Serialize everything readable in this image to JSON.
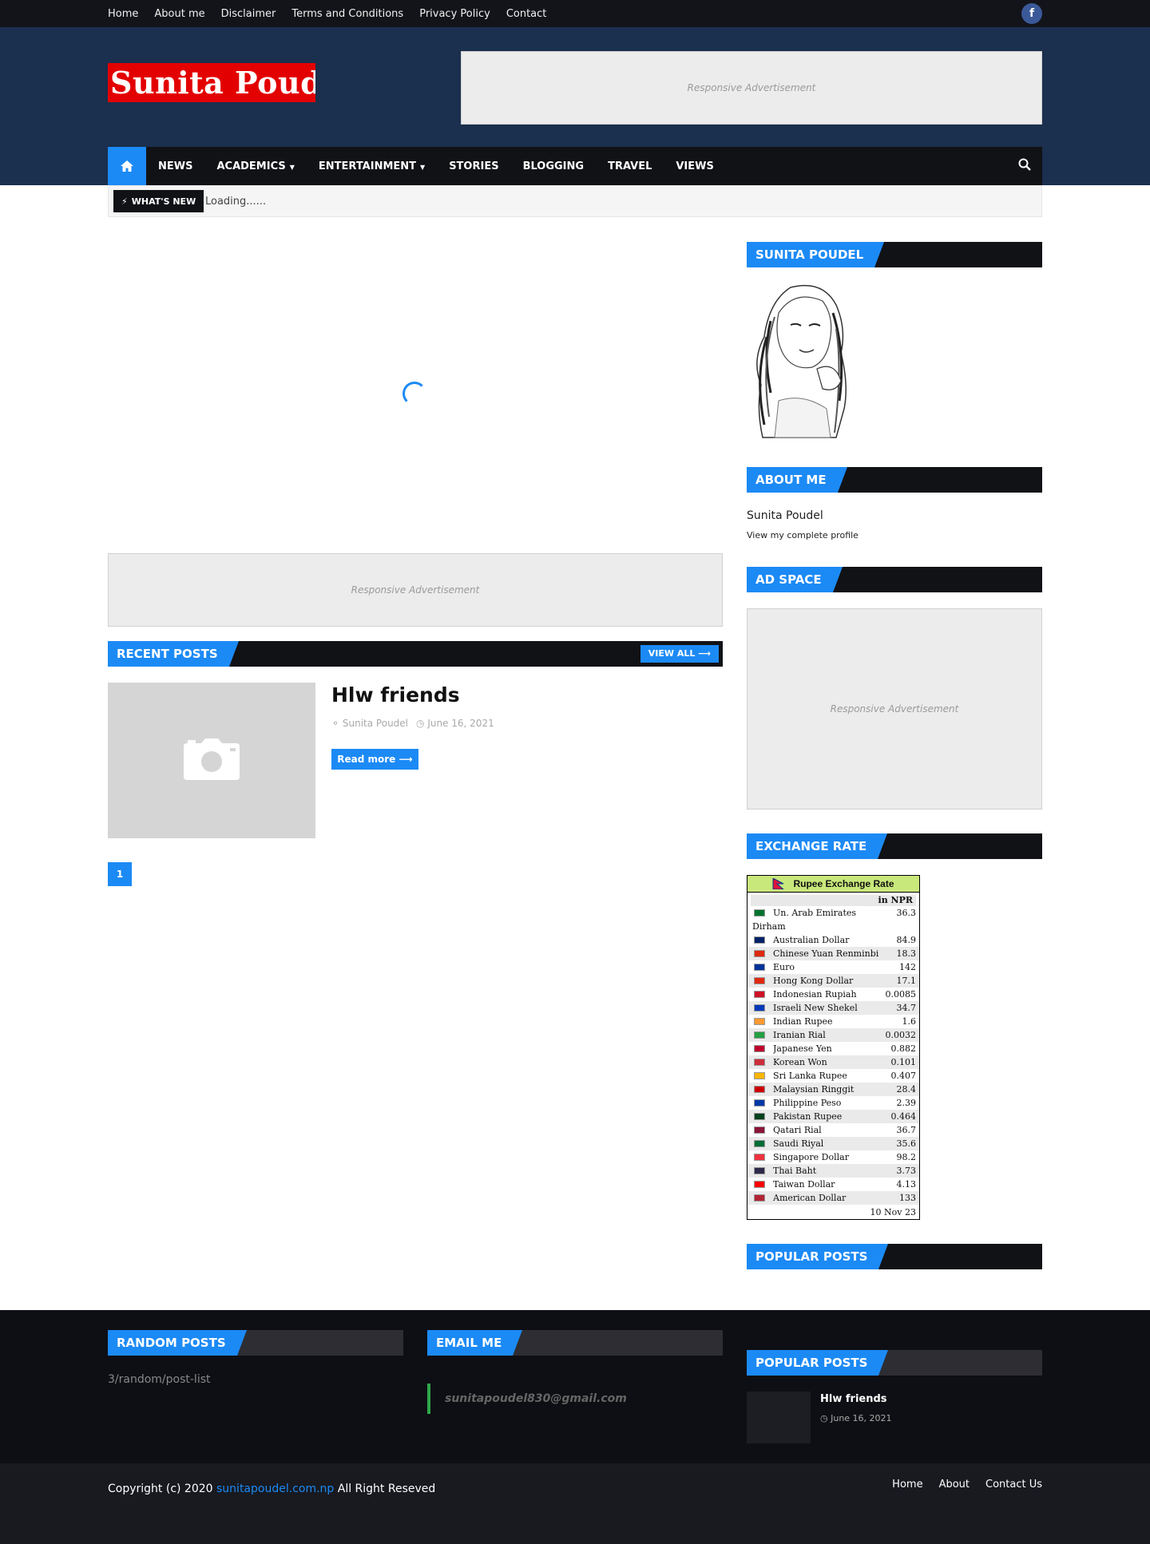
{
  "topbar": {
    "links": [
      "Home",
      "About me",
      "Disclaimer",
      "Terms and Conditions",
      "Privacy Policy",
      "Contact"
    ],
    "facebook_icon": "f"
  },
  "header": {
    "logo_text": "Sunita Poudel",
    "ad_text": "Responsive Advertisement"
  },
  "nav": {
    "items": [
      "NEWS",
      "ACADEMICS",
      "ENTERTAINMENT",
      "STORIES",
      "BLOGGING",
      "TRAVEL",
      "VIEWS"
    ]
  },
  "ticker": {
    "label": "WHAT'S NEW",
    "text": "Loading......"
  },
  "main": {
    "ad_text": "Responsive Advertisement",
    "recent_title": "RECENT POSTS",
    "view_all": "VIEW ALL",
    "post": {
      "title": "Hlw friends",
      "author": "Sunita Poudel",
      "date": "June 16, 2021",
      "read_more": "Read more"
    },
    "page": "1"
  },
  "sidebar": {
    "profile_title": "SUNITA POUDEL",
    "about_title": "ABOUT ME",
    "about_name": "Sunita Poudel",
    "view_profile": "View my complete profile",
    "ad_title": "AD SPACE",
    "ad_text": "Responsive Advertisement",
    "exchange_title": "EXCHANGE RATE",
    "popular_title": "POPULAR POSTS"
  },
  "exchange": {
    "header": "Rupee Exchange Rate",
    "unit": "in NPR",
    "first": {
      "name": "Un. Arab Emirates",
      "value": "36.3",
      "wrap": "Dirham"
    },
    "rows": [
      {
        "name": "Australian Dollar",
        "value": "84.9"
      },
      {
        "name": "Chinese Yuan Renminbi",
        "value": "18.3"
      },
      {
        "name": "Euro",
        "value": "142"
      },
      {
        "name": "Hong Kong Dollar",
        "value": "17.1"
      },
      {
        "name": "Indonesian Rupiah",
        "value": "0.0085"
      },
      {
        "name": "Israeli New Shekel",
        "value": "34.7"
      },
      {
        "name": "Indian Rupee",
        "value": "1.6"
      },
      {
        "name": "Iranian Rial",
        "value": "0.0032"
      },
      {
        "name": "Japanese Yen",
        "value": "0.882"
      },
      {
        "name": "Korean Won",
        "value": "0.101"
      },
      {
        "name": "Sri Lanka Rupee",
        "value": "0.407"
      },
      {
        "name": "Malaysian Ringgit",
        "value": "28.4"
      },
      {
        "name": "Philippine Peso",
        "value": "2.39"
      },
      {
        "name": "Pakistan Rupee",
        "value": "0.464"
      },
      {
        "name": "Qatari Rial",
        "value": "36.7"
      },
      {
        "name": "Saudi Riyal",
        "value": "35.6"
      },
      {
        "name": "Singapore Dollar",
        "value": "98.2"
      },
      {
        "name": "Thai Baht",
        "value": "3.73"
      },
      {
        "name": "Taiwan Dollar",
        "value": "4.13"
      },
      {
        "name": "American Dollar",
        "value": "133"
      }
    ],
    "flag_colors": [
      "#00732f",
      "#012169",
      "#de2910",
      "#003399",
      "#de2910",
      "#ce1126",
      "#0038b8",
      "#ff9933",
      "#239f40",
      "#bc002d",
      "#cd2e3a",
      "#ffb700",
      "#cc0001",
      "#0038a8",
      "#01411c",
      "#8a1538",
      "#006c35",
      "#ef3340",
      "#2d2a4a",
      "#fe0000",
      "#b22234"
    ],
    "date": "10 Nov 23"
  },
  "footer": {
    "random_title": "RANDOM POSTS",
    "random_text": "3/random/post-list",
    "email_title": "EMAIL ME",
    "email": "sunitapoudel830@gmail.com",
    "popular_title": "POPULAR POSTS",
    "popular_post": {
      "title": "Hlw friends",
      "date": "June 16, 2021"
    }
  },
  "bottom": {
    "copy_prefix": "Copyright (c) 2020",
    "site": "sunitapoudel.com.np",
    "copy_suffix": "All Right Reseved",
    "links": [
      "Home",
      "About",
      "Contact Us"
    ]
  },
  "colors": {
    "accent": "#1c8af5",
    "header_bg": "#1b2f4e",
    "dark": "#111216"
  }
}
